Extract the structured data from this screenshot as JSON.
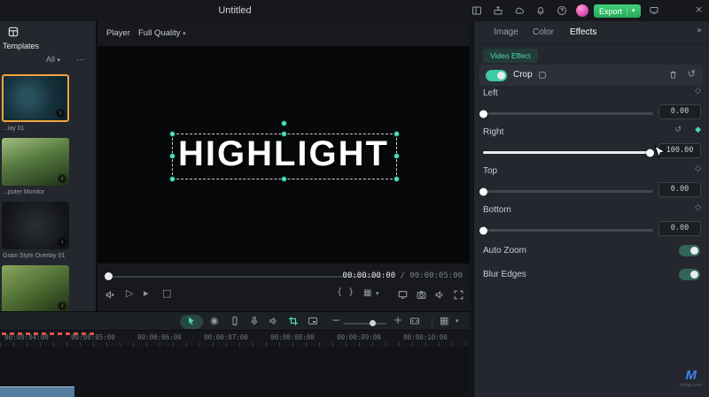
{
  "titlebar": {
    "title": "Untitled",
    "export_label": "Export"
  },
  "left_panel": {
    "title": "Templates",
    "filter_label": "All",
    "more_label": "⋯",
    "items": [
      {
        "label": "...lay 01",
        "selected": true
      },
      {
        "label": "...puter Monitor",
        "selected": false
      },
      {
        "label": "Grain Style Overlay 01",
        "selected": false
      },
      {
        "label": "",
        "selected": false
      }
    ]
  },
  "player": {
    "label": "Player",
    "quality_label": "Full Quality",
    "preview_text": "HIGHLIGHT",
    "current_time": "00:00:00:00",
    "duration": " / 00:00:05:00"
  },
  "effects_panel": {
    "tabs": [
      {
        "label": "Image",
        "active": false
      },
      {
        "label": "Color",
        "active": false
      },
      {
        "label": "Effects",
        "active": true
      }
    ],
    "badge_label": "Video Effect",
    "crop_title": "Crop",
    "crop_enabled": true,
    "sliders": [
      {
        "label": "Left",
        "value": "0.00",
        "pct": 0
      },
      {
        "label": "Right",
        "value": "100.00",
        "pct": 98
      },
      {
        "label": "Top",
        "value": "0.00",
        "pct": 0
      },
      {
        "label": "Bottom",
        "value": "0.00",
        "pct": 0
      }
    ],
    "toggles": [
      {
        "label": "Auto Zoom",
        "on": true
      },
      {
        "label": "Blur Edges",
        "on": true
      }
    ]
  },
  "timeline": {
    "ruler_labels": [
      "00:00:04:00",
      "00:00:05:00",
      "00:00:06:00",
      "00:00:07:00",
      "00:00:08:00",
      "00:00:09:00",
      "00:00:10:00"
    ]
  },
  "watermark": {
    "logo": "M",
    "text": "mfvai.com"
  },
  "colors": {
    "accent": "#4fd6b8",
    "export_green": "#35c765",
    "selection": "#f0a43c"
  }
}
